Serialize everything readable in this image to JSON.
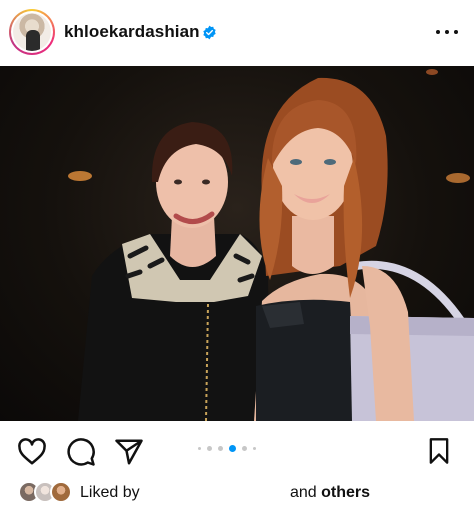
{
  "post": {
    "username": "khloekardashian",
    "verified_icon": "verified-badge-icon",
    "more_icon": "more-options-icon"
  },
  "carousel": {
    "count": 5,
    "active_index": 3
  },
  "actions": {
    "like_icon": "heart-icon",
    "comment_icon": "comment-icon",
    "share_icon": "send-icon",
    "save_icon": "bookmark-icon"
  },
  "likes": {
    "liked_by": "Liked by",
    "and_text": "and",
    "others_text": "others"
  },
  "colors": {
    "accent": "#0095f6",
    "text": "#111111"
  }
}
